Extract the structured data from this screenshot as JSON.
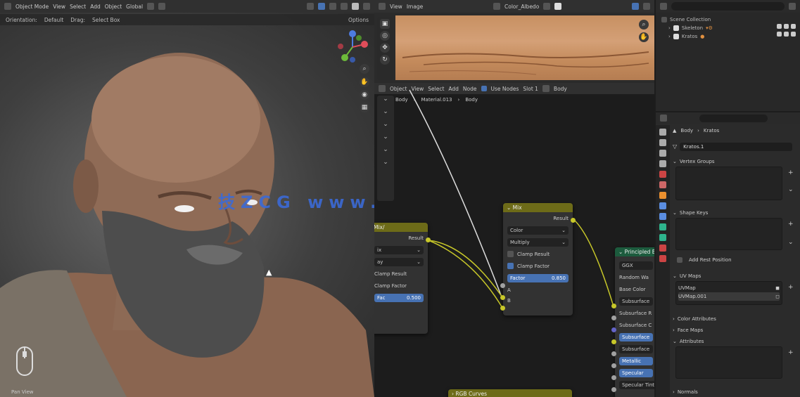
{
  "viewport": {
    "mode": "Object Mode",
    "menu": [
      "View",
      "Select",
      "Add",
      "Object"
    ],
    "global": "Global",
    "sub_toolbar": [
      "Orientation:",
      "Default",
      "Drag:",
      "Select Box"
    ],
    "options": "Options",
    "watermark": "技ZCG  www.qdnxxfb.cn",
    "status_text": "Pan View"
  },
  "image_editor": {
    "menu": [
      "View",
      "Image"
    ],
    "image_name": "Color_Albedo"
  },
  "node_editor": {
    "header": [
      "Object",
      "View",
      "Select",
      "Add",
      "Node",
      "Use Nodes",
      "Slot 1",
      "Body"
    ],
    "breadcrumb": [
      "Body",
      "Material.013",
      "Body"
    ],
    "nodes": {
      "left": {
        "title": "Mix/",
        "out": "Result",
        "dropdown1": "ix",
        "dropdown2": "ay",
        "opt1": "Clamp Result",
        "opt2": "Clamp Factor",
        "fac_label": "Fac",
        "fac_value": "0.500"
      },
      "mix": {
        "title": "Mix",
        "out": "Result",
        "dropdown1": "Color",
        "dropdown2": "Multiply",
        "opt1": "Clamp Result",
        "opt2": "Clamp Factor",
        "fac_label": "Factor",
        "fac_value": "0.850",
        "in_a": "A",
        "in_b": "B"
      },
      "bsdf": {
        "title": "Principled B",
        "r1": "GGX",
        "r2": "Random Wa",
        "r3": "Base Color",
        "r4": "Subsurface",
        "r5": "Subsurface R",
        "r6": "Subsurface C",
        "r7": "Subsurface",
        "r8": "Subsurface",
        "r9": "Metallic",
        "r10": "Specular",
        "r11": "Specular Tint"
      },
      "bottom": {
        "title": "RGB Curves"
      }
    }
  },
  "outliner": {
    "root": "Scene Collection",
    "items": [
      "Skeleton",
      "Kratos"
    ]
  },
  "properties": {
    "breadcrumb": [
      "Body",
      "Kratos"
    ],
    "object_name": "Kratos.1",
    "panels": {
      "vertex_groups": "Vertex Groups",
      "shape_keys": "Shape Keys",
      "rest_position": "Add Rest Position",
      "uv_maps": "UV Maps",
      "uv_items": [
        "UVMap",
        "UVMap.001"
      ],
      "color_attributes": "Color Attributes",
      "face_maps": "Face Maps",
      "attributes": "Attributes",
      "normals": "Normals"
    }
  },
  "colors": {
    "accent": "#4772b3",
    "node_header": "#6d6b18",
    "socket_yellow": "#c7c729",
    "node_link": "#c7c729",
    "watermark": "#3b6ad6"
  }
}
